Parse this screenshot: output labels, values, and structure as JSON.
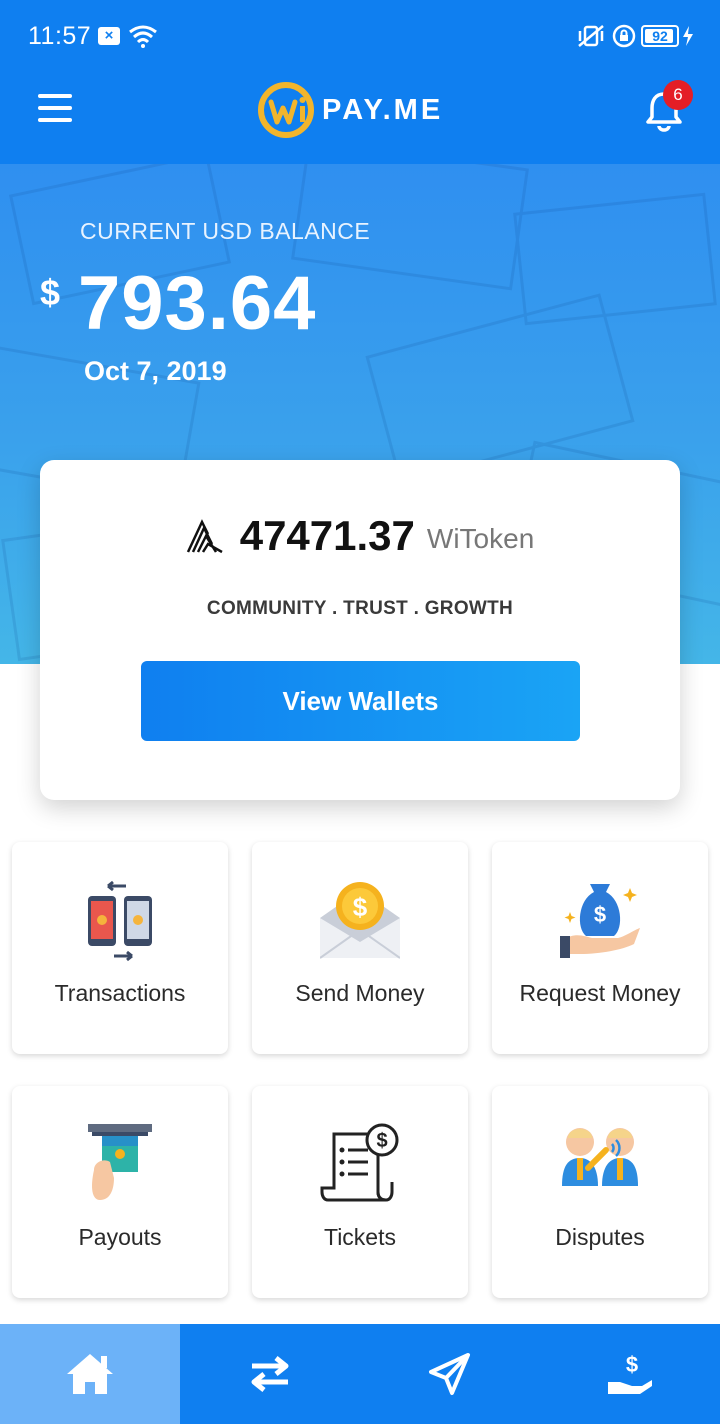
{
  "status_bar": {
    "time": "11:57",
    "battery": "92"
  },
  "app_bar": {
    "logo_text": "PAY.ME",
    "notification_count": "6"
  },
  "balance": {
    "label": "CURRENT USD BALANCE",
    "currency_symbol": "$",
    "amount": "793.64",
    "date": "Oct 7, 2019"
  },
  "token_card": {
    "value": "47471.37",
    "unit": "WiToken",
    "tagline": "COMMUNITY . TRUST . GROWTH",
    "button_label": "View Wallets"
  },
  "tiles": [
    {
      "label": "Transactions",
      "icon": "transactions-icon"
    },
    {
      "label": "Send Money",
      "icon": "send-money-icon"
    },
    {
      "label": "Request Money",
      "icon": "request-money-icon"
    },
    {
      "label": "Payouts",
      "icon": "payouts-icon"
    },
    {
      "label": "Tickets",
      "icon": "tickets-icon"
    },
    {
      "label": "Disputes",
      "icon": "disputes-icon"
    }
  ],
  "bottom_nav": [
    {
      "icon": "home-icon",
      "active": true
    },
    {
      "icon": "transfer-icon",
      "active": false
    },
    {
      "icon": "send-icon",
      "active": false
    },
    {
      "icon": "request-icon",
      "active": false
    }
  ],
  "colors": {
    "primary": "#0f7ff0",
    "nav_active": "#6cb2f8",
    "badge": "#e41e26",
    "logo_accent": "#f2b52c"
  }
}
